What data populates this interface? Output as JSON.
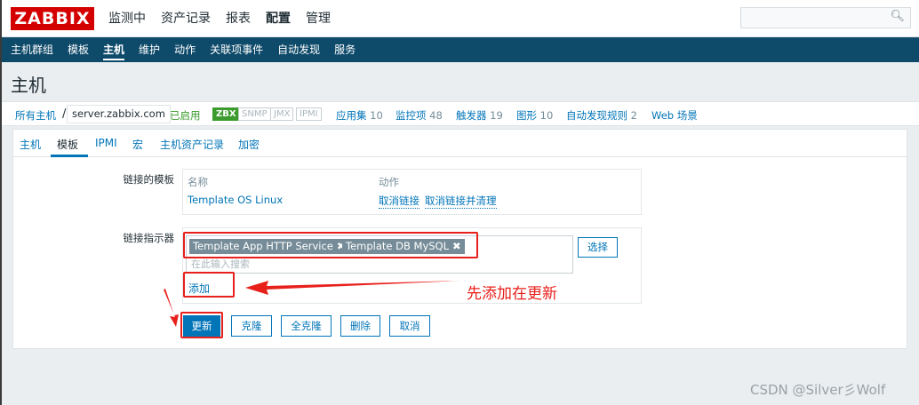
{
  "topbar": {
    "logo": "ZABBIX",
    "nav": [
      "监测中",
      "资产记录",
      "报表",
      "配置",
      "管理"
    ],
    "active": "配置"
  },
  "subnav": {
    "items": [
      "主机群组",
      "模板",
      "主机",
      "维护",
      "动作",
      "关联项事件",
      "自动发现",
      "服务"
    ],
    "active": "主机"
  },
  "page": {
    "title": "主机"
  },
  "breadcrumb": {
    "all_hosts": "所有主机",
    "separator": "/",
    "host": "server.zabbix.com",
    "status": "已启用",
    "availability": [
      "ZBX",
      "SNMP",
      "JMX",
      "IPMI"
    ],
    "apps_label": "应用集",
    "apps_count": "10",
    "items_label": "监控项",
    "items_count": "48",
    "triggers_label": "触发器",
    "triggers_count": "19",
    "graphs_label": "图形",
    "graphs_count": "10",
    "discovery_label": "自动发现规则",
    "discovery_count": "2",
    "web_label": "Web 场景"
  },
  "tabs": [
    "主机",
    "模板",
    "IPMI",
    "宏",
    "主机资产记录",
    "加密"
  ],
  "form": {
    "linked_templates_label": "链接的模板",
    "col_name": "名称",
    "col_action": "动作",
    "template_name": "Template OS Linux",
    "unlink": "取消链接",
    "unlink_clear": "取消链接并清理",
    "link_new_label": "链接指示器",
    "chips": [
      "Template App HTTP Service",
      "Template DB MySQL"
    ],
    "search_placeholder": "在此输入搜索",
    "select_button": "选择",
    "add_link": "添加"
  },
  "buttons": {
    "update": "更新",
    "clone": "克隆",
    "full_clone": "全克隆",
    "delete": "删除",
    "cancel": "取消"
  },
  "annotation": {
    "text": "先添加在更新"
  },
  "watermark": "CSDN @Silver彡Wolf",
  "colors": {
    "brand_red": "#d40000",
    "nav_blue": "#0e4a6a",
    "link_blue": "#0275b8",
    "enabled_green": "#3b9b2d",
    "annotation_red": "#e8201c"
  }
}
